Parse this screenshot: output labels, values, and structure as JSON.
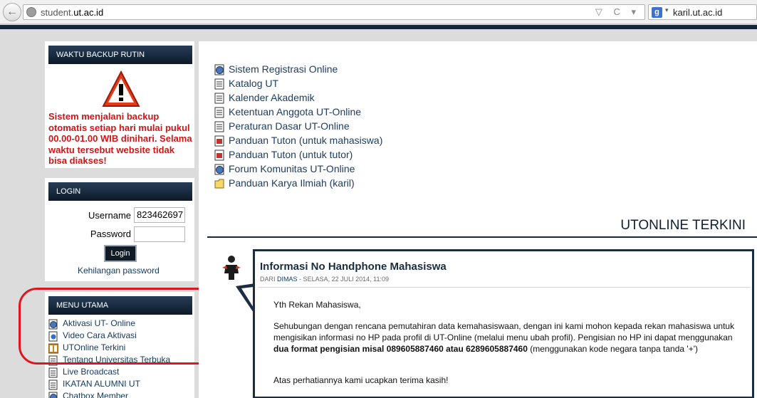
{
  "browser": {
    "url_prefix": "student.",
    "url_domain": "ut.ac.id",
    "search_engine": "g-icon",
    "search_text": "karil.ut.ac.id"
  },
  "sidebar": {
    "backup": {
      "title": "WAKTU BACKUP RUTIN",
      "message": "Sistem menjalani backup otomatis setiap hari mulai pukul 00.00-01.00 WIB dinihari. Selama waktu tersebut website tidak bisa diakses!"
    },
    "login": {
      "title": "LOGIN",
      "username_label": "Username",
      "username_value": "823462697",
      "password_label": "Password",
      "button_label": "Login",
      "lost_password": "Kehilangan password"
    },
    "menu": {
      "title": "MENU UTAMA",
      "items": [
        {
          "label": "Aktivasi UT- Online",
          "icon": "globe-doc-icon"
        },
        {
          "label": "Video Cara Aktivasi",
          "icon": "video-icon"
        },
        {
          "label": "UTOnline Terkini",
          "icon": "news-icon"
        },
        {
          "label": "Tentang Universitas Terbuka",
          "icon": "document-icon"
        },
        {
          "label": "Live Broadcast",
          "icon": "document-icon"
        },
        {
          "label": "IKATAN ALUMNI UT",
          "icon": "document-icon"
        },
        {
          "label": "Chatbox Member",
          "icon": "globe-doc-icon"
        }
      ]
    }
  },
  "main": {
    "links": [
      {
        "label": "Sistem Registrasi Online",
        "icon": "globe-doc-icon"
      },
      {
        "label": "Katalog UT",
        "icon": "document-icon"
      },
      {
        "label": "Kalender Akademik",
        "icon": "document-icon"
      },
      {
        "label": "Ketentuan Anggota UT-Online",
        "icon": "document-icon"
      },
      {
        "label": "Peraturan Dasar UT-Online",
        "icon": "document-icon"
      },
      {
        "label": "Panduan Tuton (untuk mahasiswa)",
        "icon": "pdf-icon"
      },
      {
        "label": "Panduan Tuton (untuk tutor)",
        "icon": "pdf-icon"
      },
      {
        "label": "Forum Komunitas UT-Online",
        "icon": "globe-doc-icon"
      },
      {
        "label": "Panduan Karya Ilmiah (karil)",
        "icon": "folder-icon"
      }
    ],
    "section_title": "UTONLINE TERKINI",
    "post": {
      "title": "Informasi No Handphone Mahasiswa",
      "meta_prefix": "DARI",
      "author": "DIMAS",
      "meta_date": "- SELASA, 22 JULI 2014, 11:09",
      "greeting": "Yth Rekan Mahasiswa,",
      "body_part1": "Sehubungan dengan rencana pemutahiran data kemahasiswaan, dengan ini kami mohon kepada rekan mahasiswa untuk mengisikan informasi no HP pada profil di UT-Online (melalui menu ubah profil). Pengisian no HP ini dapat menggunakan",
      "body_bold": "dua format pengisian misal 089605887460 atau 6289605887460",
      "body_part2": "(menggunakan kode negara tanpa tanda '+')",
      "closing": "Atas perhatiannya kami ucapkan terima kasih!"
    }
  },
  "colors": {
    "header_bar": "#16263a",
    "warning_text": "#d31414",
    "link": "#1d3d63",
    "highlight": "#e0161d"
  }
}
